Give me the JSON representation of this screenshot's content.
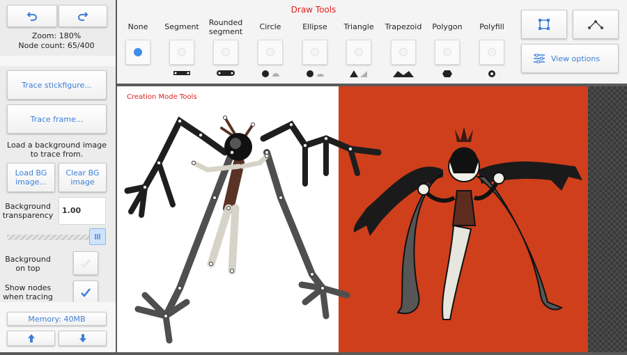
{
  "left_panel": {
    "zoom": "Zoom: 180%",
    "node_count": "Node count: 65/400",
    "trace_stickfigure": "Trace stickfigure...",
    "trace_frame": "Trace frame...",
    "load_bg_hint": "Load a background image to trace from.",
    "load_bg": "Load BG image...",
    "clear_bg": "Clear BG image",
    "bg_transparency_label": "Background transparency",
    "bg_transparency_value": "1.00",
    "bg_on_top_label": "Background on top",
    "show_nodes_label": "Show nodes when tracing",
    "memory": "Memory: 40MB",
    "slider_level": 1.0,
    "bg_on_top_checked": false,
    "show_nodes_checked": true
  },
  "toolbar": {
    "title": "Draw Tools",
    "tools": [
      {
        "label": "None",
        "selected": true
      },
      {
        "label": "Segment",
        "selected": false
      },
      {
        "label": "Rounded segment",
        "selected": false
      },
      {
        "label": "Circle",
        "selected": false
      },
      {
        "label": "Ellipse",
        "selected": false
      },
      {
        "label": "Triangle",
        "selected": false
      },
      {
        "label": "Trapezoid",
        "selected": false
      },
      {
        "label": "Polygon",
        "selected": false
      },
      {
        "label": "Polyfill",
        "selected": false
      }
    ],
    "view_options": "View options"
  },
  "canvas": {
    "mode_label": "Creation Mode Tools"
  },
  "colors": {
    "accent": "#3d7fd9",
    "title_red": "#e02020",
    "bg_orange": "#cf3f1c"
  }
}
